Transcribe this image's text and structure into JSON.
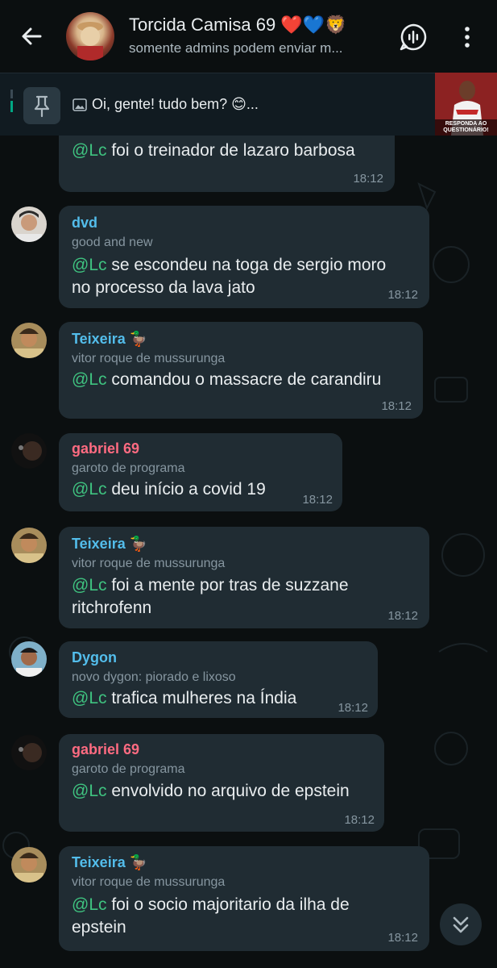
{
  "header": {
    "title": "Torcida Camisa 69 ❤️💙🦁",
    "subtitle": "somente admins podem enviar m..."
  },
  "pinned": {
    "text": "Oi, gente! tudo bem? 😊...",
    "thumb_caption": "RESPONDA AO QUESTIONÁRIO!"
  },
  "messages": [
    {
      "sender": "",
      "about": "",
      "mention": "@Lc",
      "text": " foi o treinador de lazaro barbosa",
      "time": "18:12"
    },
    {
      "sender": "dvd",
      "about": "good and new",
      "mention": "@Lc",
      "text": " se escondeu na toga de sergio moro",
      "text2": "no processo da lava jato",
      "time": "18:12"
    },
    {
      "sender": "Teixeira 🦆",
      "about": "vitor roque de mussurunga",
      "mention": "@Lc",
      "text": " comandou o massacre de carandiru",
      "time": "18:12"
    },
    {
      "sender": "gabriel 69",
      "about": "garoto de programa",
      "mention": "@Lc",
      "text": " deu início a covid 19",
      "time": "18:12"
    },
    {
      "sender": "Teixeira 🦆",
      "about": "vitor roque de mussurunga",
      "mention": "@Lc",
      "text": " foi a mente por tras de suzzane",
      "text2": "ritchrofenn",
      "time": "18:12"
    },
    {
      "sender": "Dygon",
      "about": "novo dygon: piorado e lixoso",
      "mention": "@Lc",
      "text": " trafica mulheres na Índia",
      "time": "18:12"
    },
    {
      "sender": "gabriel 69",
      "about": "garoto de programa",
      "mention": "@Lc",
      "text": " envolvido no arquivo de epstein",
      "time": "18:12"
    },
    {
      "sender": "Teixeira 🦆",
      "about": "vitor roque de mussurunga",
      "mention": "@Lc",
      "text": " foi o socio majoritario da ilha de",
      "text2": "epstein",
      "time": "18:12"
    }
  ],
  "colors": {
    "dvd": "#53bdeb",
    "teixeira": "#53bdeb",
    "gabriel": "#ff6b81",
    "dygon": "#53bdeb",
    "mention": "#3fc380",
    "bubble": "#202c33"
  }
}
